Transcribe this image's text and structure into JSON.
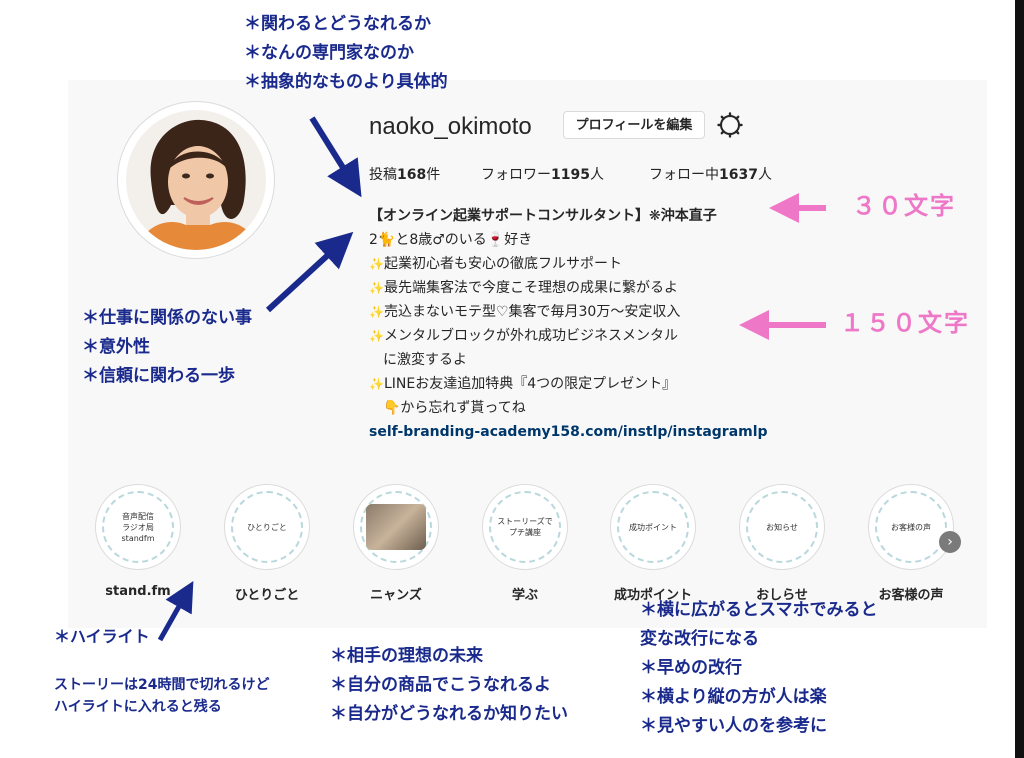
{
  "annotations": {
    "top": [
      "＊関わるとどうなれるか",
      "＊なんの専門家なのか",
      "＊抽象的なものより具体的"
    ],
    "left_middle": [
      "＊仕事に関係のない事",
      "＊意外性",
      "＊信頼に関わる一歩"
    ],
    "highlight_title": "＊ハイライト",
    "highlight_note": [
      "ストーリーは24時間で切れるけど",
      "ハイライトに入れると残る"
    ],
    "bottom_middle": [
      "＊相手の理想の未来",
      "＊自分の商品でこうなれるよ",
      "＊自分がどうなれるか知りたい"
    ],
    "bottom_right": [
      "＊横に広がるとスマホでみると",
      "変な改行になる",
      "＊早めの改行",
      "＊横より縦の方が人は楽",
      "＊見やすい人のを参考に"
    ],
    "char_30": "３０文字",
    "char_150": "１５０文字"
  },
  "profile": {
    "username": "naoko_okimoto",
    "edit_button": "プロフィールを編集",
    "stats": {
      "posts_label": "投稿",
      "posts_value": "168",
      "posts_unit": "件",
      "followers_label": "フォロワー",
      "followers_value": "1195",
      "followers_unit": "人",
      "following_label": "フォロー中",
      "following_value": "1637",
      "following_unit": "人"
    },
    "bio": {
      "name": "【オンライン起業サポートコンサルタント】❋沖本直子",
      "line1": "2🐈と8歳♂のいる🍷好き",
      "line2": "起業初心者も安心の徹底フルサポート",
      "line3": "最先端集客法で今度こそ理想の成果に繋がるよ",
      "line4": "売込まないモテ型♡集客で毎月30万〜安定収入",
      "line5": "メンタルブロックが外れ成功ビジネスメンタル",
      "line5b": "に激変するよ",
      "line6": "LINEお友達追加特典『4つの限定プレゼント』",
      "line6b": "👇から忘れず貰ってね",
      "link": "self-branding-academy158.com/instlp/instagramlp"
    }
  },
  "highlights": [
    {
      "inner": "音声配信\nラジオ局\nstandfm",
      "label": "stand.fm"
    },
    {
      "inner": "ひとりごと",
      "label": "ひとりごと"
    },
    {
      "inner": "",
      "label": "ニャンズ"
    },
    {
      "inner": "ストーリーズで\nプチ講座",
      "label": "学ぶ"
    },
    {
      "inner": "成功ポイント",
      "label": "成功ポイント"
    },
    {
      "inner": "お知らせ",
      "label": "おしらせ"
    },
    {
      "inner": "お客様の声",
      "label": "お客様の声"
    }
  ],
  "colors": {
    "annotation": "#1a2a8c",
    "pink": "#ee77c8",
    "link": "#00376b"
  }
}
